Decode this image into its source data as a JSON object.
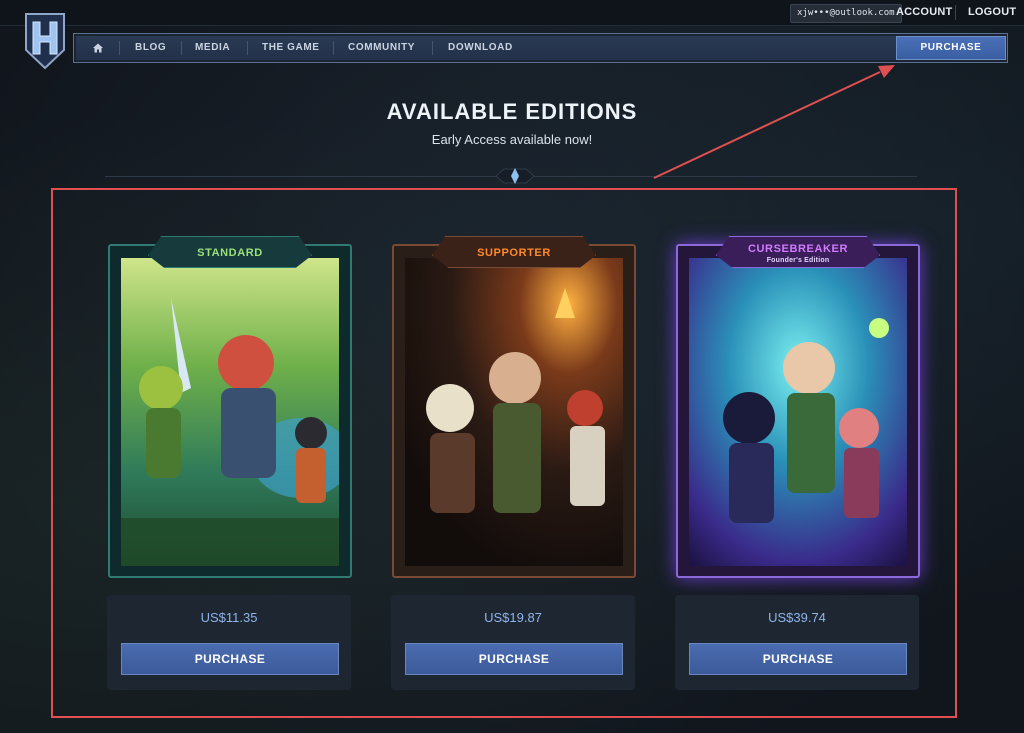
{
  "topbar": {
    "email": "xjw•••@outlook.com",
    "account_label": "ACCOUNT",
    "logout_label": "LOGOUT"
  },
  "logo": {
    "icon": "hytale-h-shield-logo"
  },
  "nav": {
    "home_icon": "home-icon",
    "items": [
      "BLOG",
      "MEDIA",
      "THE GAME",
      "COMMUNITY",
      "DOWNLOAD"
    ],
    "purchase_label": "PURCHASE"
  },
  "page": {
    "title": "AVAILABLE EDITIONS",
    "subtitle": "Early Access available now!"
  },
  "editions": [
    {
      "name": "STANDARD",
      "subtitle": "",
      "price": "US$11.35",
      "button_label": "PURCHASE",
      "accent": "#9be07a"
    },
    {
      "name": "SUPPORTER",
      "subtitle": "",
      "price": "US$19.87",
      "button_label": "PURCHASE",
      "accent": "#ff8a2a"
    },
    {
      "name": "CURSEBREAKER",
      "subtitle": "Founder's Edition",
      "price": "US$39.74",
      "button_label": "PURCHASE",
      "accent": "#d27bff"
    }
  ],
  "colors": {
    "annotation": "#e05050",
    "button": "#4565a8",
    "background": "#141a22"
  }
}
